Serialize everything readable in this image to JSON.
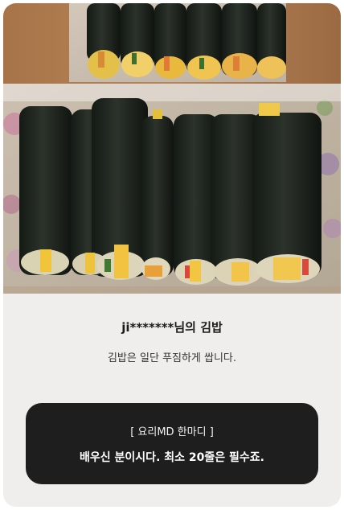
{
  "photo": {
    "alt_icon": "kimbap-photo"
  },
  "review": {
    "author": "ji*******님의 김밥",
    "description": "김밥은 일단 푸짐하게 쌉니다."
  },
  "md_comment": {
    "title": "[ 요리MD 한마디 ]",
    "text": "배우신 분이시다. 최소 20줄은 필수죠."
  }
}
